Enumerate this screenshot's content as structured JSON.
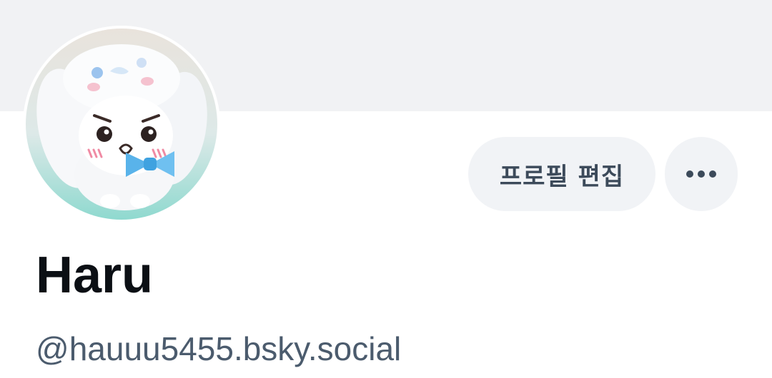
{
  "profile": {
    "display_name": "Haru",
    "handle": "@hauuu5455.bsky.social",
    "avatar_icon": "plush-avatar-icon"
  },
  "actions": {
    "edit_profile_label": "프로필 편집",
    "more_icon": "ellipsis-icon"
  },
  "colors": {
    "banner": "#f1f2f4",
    "button_bg": "#f1f3f6",
    "button_text": "#3c4a5a",
    "name_text": "#0b0f14",
    "handle_text": "#4b5b6d"
  }
}
